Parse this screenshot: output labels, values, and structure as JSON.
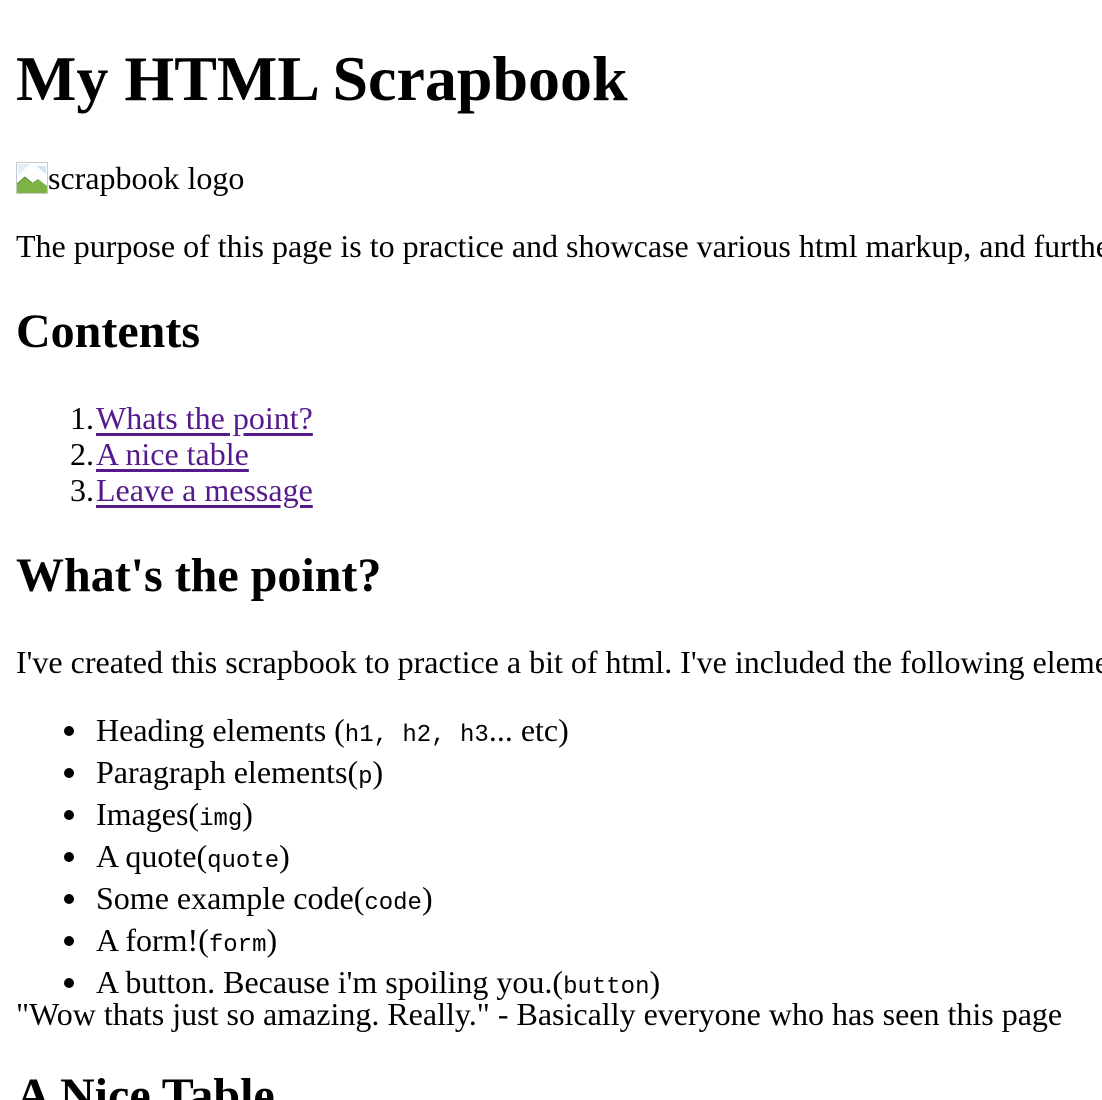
{
  "header": {
    "title": "My HTML Scrapbook"
  },
  "logo": {
    "alt_text": "scrapbook logo",
    "icon": "broken-image-icon"
  },
  "intro": {
    "text": "The purpose of this page is to practice and showcase various html markup, and furthe"
  },
  "contents": {
    "heading": "Contents",
    "items": [
      {
        "number": "1.",
        "label": "Whats the point?"
      },
      {
        "number": "2.",
        "label": "A nice table"
      },
      {
        "number": "3.",
        "label": "Leave a message"
      }
    ],
    "link_color": "#551a8b"
  },
  "point": {
    "heading": "What's the point?",
    "paragraph": "I've created this scrapbook to practice a bit of html. I've included the following eleme",
    "elements": [
      {
        "text": "Heading elements (",
        "code": "h1, h2, h3",
        "suffix": "... etc)"
      },
      {
        "text": "Paragraph elements(",
        "code": "p",
        "suffix": ")"
      },
      {
        "text": "Images(",
        "code": "img",
        "suffix": ")"
      },
      {
        "text": "A quote(",
        "code": "quote",
        "suffix": ")"
      },
      {
        "text": "Some example code(",
        "code": "code",
        "suffix": ")"
      },
      {
        "text": "A form!(",
        "code": "form",
        "suffix": ")"
      },
      {
        "text": "A button. Because i'm spoiling you.(",
        "code": "button",
        "suffix": ")"
      }
    ],
    "quote": "\"Wow thats just so amazing. Really.\" - Basically everyone who has seen this page"
  },
  "table_section": {
    "heading": "A Nice Table"
  }
}
